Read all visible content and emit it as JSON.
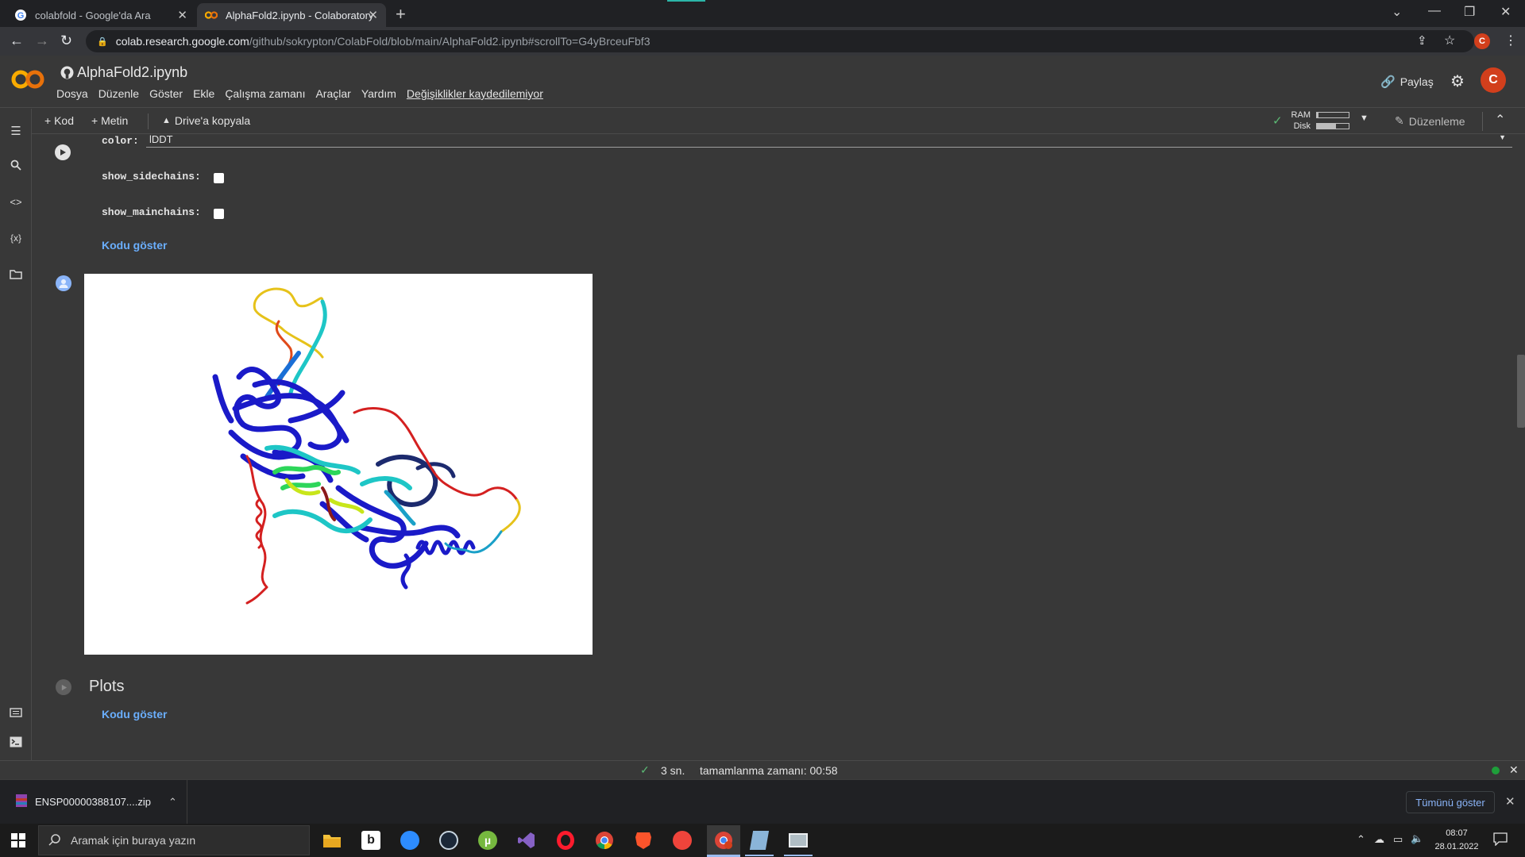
{
  "browser": {
    "tabs": [
      {
        "title": "colabfold - Google'da Ara",
        "icon": "google-icon"
      },
      {
        "title": "AlphaFold2.ipynb - Colaboratory",
        "icon": "colab-icon",
        "active": true
      }
    ],
    "url_host": "colab.research.google.com",
    "url_path": "/github/sokrypton/ColabFold/blob/main/AlphaFold2.ipynb#scrollTo=G4yBrceuFbf3",
    "profile_initial": "C"
  },
  "colab": {
    "notebook_title": "AlphaFold2.ipynb",
    "menu": [
      "Dosya",
      "Düzenle",
      "Göster",
      "Ekle",
      "Çalışma zamanı",
      "Araçlar",
      "Yardım"
    ],
    "unsaved_notice": "Değişiklikler kaydedilemiyor",
    "share_label": "Paylaş",
    "profile_initial": "C",
    "toolbar": {
      "add_code": "Kod",
      "add_text": "Metin",
      "copy_to_drive": "Drive'a kopyala",
      "ram_label": "RAM",
      "disk_label": "Disk",
      "ram_usage": 0.05,
      "disk_usage": 0.6,
      "editing_label": "Düzenleme"
    }
  },
  "cells": {
    "form": {
      "color_label": "color:",
      "color_value": "lDDT",
      "show_sidechains_label": "show_sidechains:",
      "show_sidechains_checked": false,
      "show_mainchains_label": "show_mainchains:",
      "show_mainchains_checked": false,
      "show_code": "Kodu göster"
    },
    "plots": {
      "title": "Plots",
      "show_code": "Kodu göster"
    }
  },
  "status": {
    "elapsed": "3 sn.",
    "completed": "tamamlanma zamanı: 00:58"
  },
  "downloads": {
    "file_name": "ENSP00000388107....zip",
    "show_all": "Tümünü göster"
  },
  "taskbar": {
    "search_placeholder": "Aramak için buraya yazın",
    "time": "08:07",
    "date": "28.01.2022"
  }
}
